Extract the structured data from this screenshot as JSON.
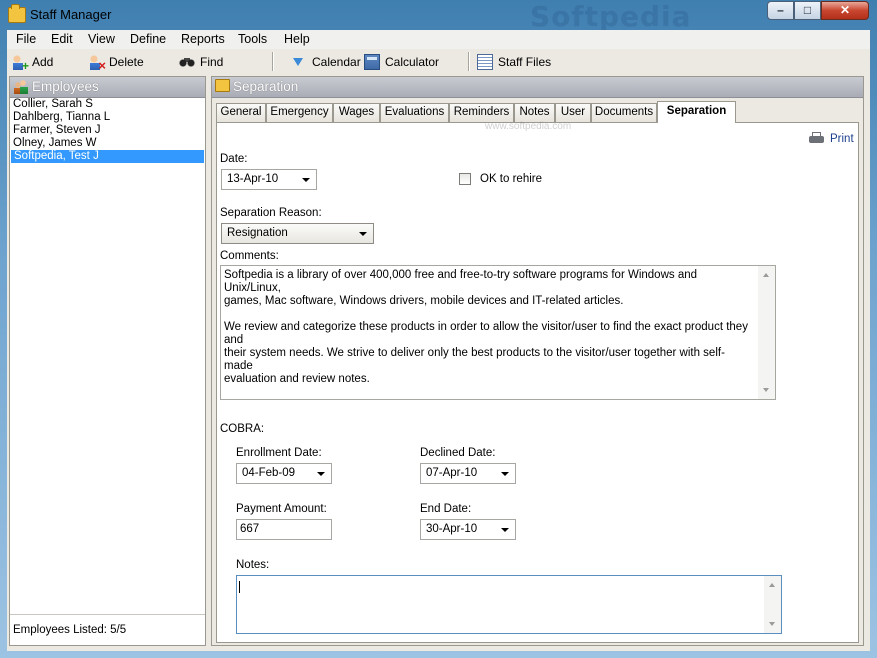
{
  "window": {
    "title": "Staff Manager",
    "watermark": "Softpedia",
    "minimize": "–",
    "maximize": "□",
    "close": "✕"
  },
  "menu": [
    {
      "label": "File"
    },
    {
      "label": "Edit"
    },
    {
      "label": "View"
    },
    {
      "label": "Define"
    },
    {
      "label": "Reports"
    },
    {
      "label": "Tools"
    },
    {
      "label": "Help"
    }
  ],
  "toolbar": {
    "add": "Add",
    "delete": "Delete",
    "find": "Find",
    "calendar": "Calendar",
    "calculator": "Calculator",
    "staff_files": "Staff Files"
  },
  "employees": {
    "header": "Employees",
    "items": [
      "Collier, Sarah S",
      "Dahlberg, Tianna L",
      "Farmer, Steven J",
      "Olney, James W",
      "Softpedia, Test J"
    ],
    "selected_index": 4,
    "footer": "Employees Listed: 5/5"
  },
  "separation": {
    "header": "Separation",
    "tabs": [
      "General",
      "Emergency",
      "Wages",
      "Evaluations",
      "Reminders",
      "Notes",
      "User",
      "Documents",
      "Separation"
    ],
    "active_tab": "Separation",
    "tab_watermark": "www.softpedia.com",
    "print_label": "Print",
    "date_label": "Date:",
    "date_value": "13-Apr-10",
    "ok_rehire_label": "OK to rehire",
    "ok_rehire_checked": false,
    "reason_label": "Separation Reason:",
    "reason_value": "Resignation",
    "comments_label": "Comments:",
    "comments_text": "Softpedia is a library of over 400,000 free and free-to-try software programs for Windows and Unix/Linux,\ngames, Mac software, Windows drivers, mobile devices and IT-related articles.\n\nWe review and categorize these products in order to allow the visitor/user to find the exact product they and\ntheir system needs. We strive to deliver only the best products to the visitor/user together with self-made\nevaluation and review notes.",
    "cobra_label": "COBRA:",
    "enrollment_label": "Enrollment Date:",
    "enrollment_value": "04-Feb-09",
    "declined_label": "Declined Date:",
    "declined_value": "07-Apr-10",
    "payment_label": "Payment Amount:",
    "payment_value": "667",
    "end_label": "End Date:",
    "end_value": "30-Apr-10",
    "notes_label": "Notes:",
    "notes_text": ""
  }
}
